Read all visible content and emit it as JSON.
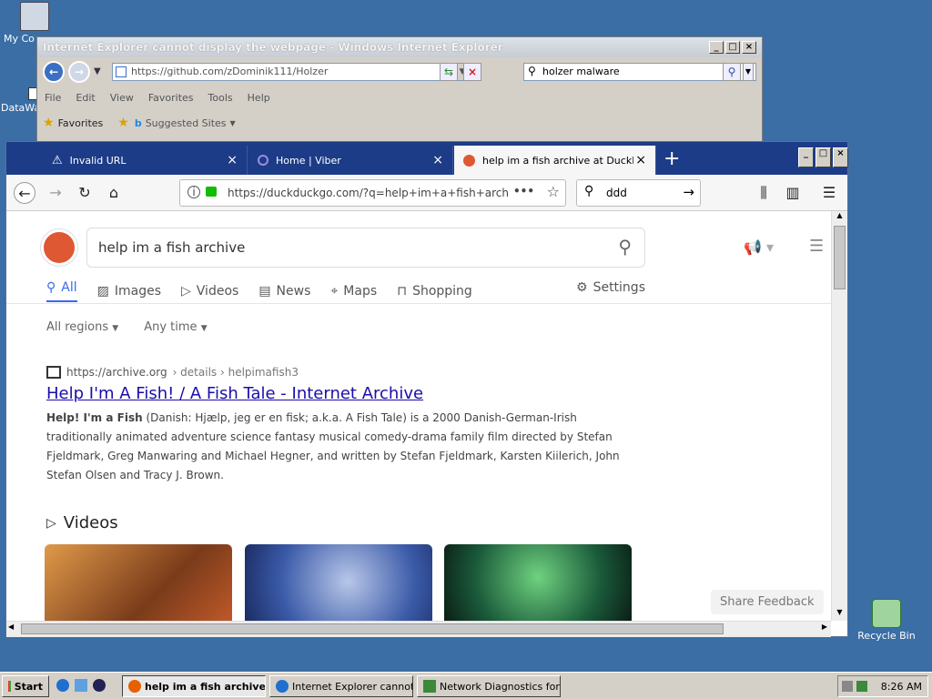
{
  "desktop": {
    "icons": [
      {
        "label": "My Co"
      },
      {
        "label": "DataWa"
      },
      {
        "label": "Recycle Bin"
      }
    ]
  },
  "ie": {
    "title": "Internet Explorer cannot display the webpage - Windows Internet Explorer",
    "address": "https://github.com/zDominik111/Holzer",
    "search": "holzer malware",
    "menu": [
      "File",
      "Edit",
      "View",
      "Favorites",
      "Tools",
      "Help"
    ],
    "favorites_label": "Favorites",
    "suggested_label": "Suggested Sites"
  },
  "firefox": {
    "tabs": [
      {
        "label": "Invalid URL"
      },
      {
        "label": "Home | Viber"
      },
      {
        "label": "help im a fish archive at DuckDuck"
      }
    ],
    "url": "https://duckduckgo.com/?q=help+im+a+fish+arch",
    "search": "ddd",
    "ddg": {
      "query": "help im a fish archive",
      "tabs": [
        "All",
        "Images",
        "Videos",
        "News",
        "Maps",
        "Shopping"
      ],
      "settings": "Settings",
      "region": "All regions",
      "time": "Any time",
      "result": {
        "source": "https://archive.org",
        "path": "› details › helpimafish3",
        "title": "Help I'm A Fish! / A Fish Tale - Internet Archive",
        "desc_bold1": "Help! I'm a Fish",
        "desc_rest": " (Danish: Hjælp, jeg er en fisk; a.k.a. A Fish Tale) is a 2000 Danish-German-Irish traditionally animated adventure science fantasy musical comedy-drama family film directed by Stefan Fjeldmark, Greg Manwaring and Michael Hegner, and written by Stefan Fjeldmark, Karsten Kiilerich, John Stefan Olsen and Tracy J. Brown."
      },
      "videos_heading": "Videos",
      "feedback": "Share Feedback"
    }
  },
  "taskbar": {
    "start": "Start",
    "tasks": [
      {
        "label": "help im a fish archive ..."
      },
      {
        "label": "Internet Explorer cannot..."
      },
      {
        "label": "Network Diagnostics for ..."
      }
    ],
    "clock": "8:26 AM"
  }
}
